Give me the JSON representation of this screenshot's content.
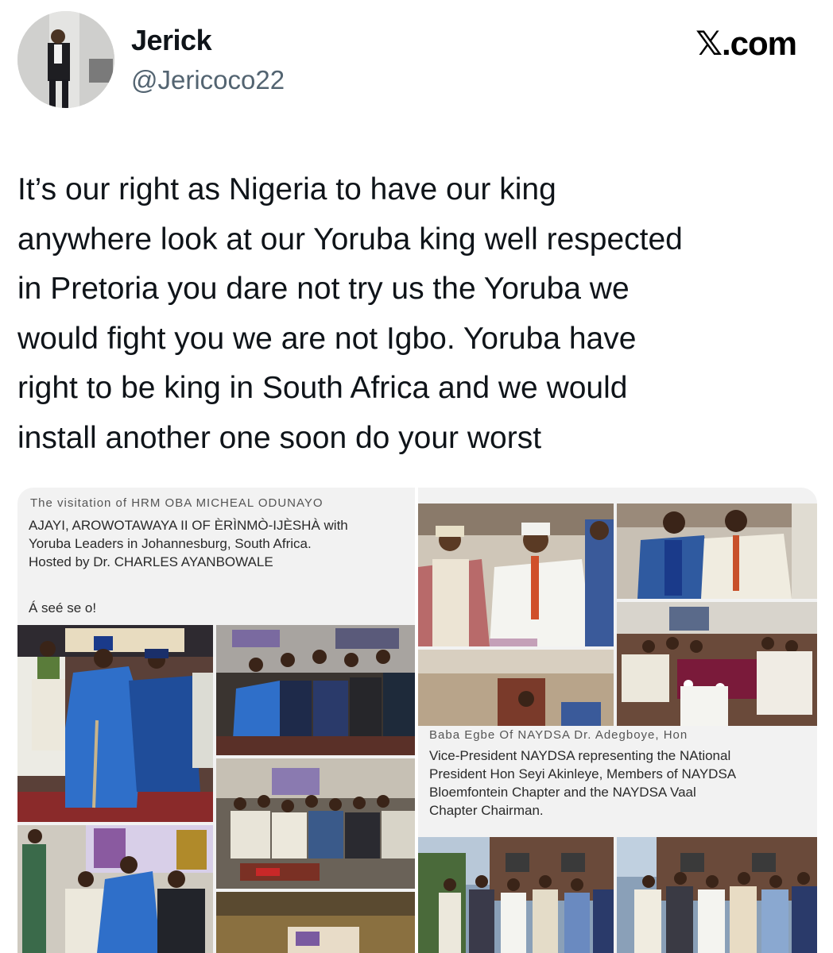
{
  "header": {
    "display_name": "Jerick",
    "handle": "@Jericoco22",
    "source": "𝕏.com"
  },
  "tweet": {
    "lines": [
      "It’s our right as Nigeria to have our king",
      "anywhere look at our Yoruba king well respected",
      "in Pretoria you dare not try us the Yoruba we",
      "would fight you we are not Igbo. Yoruba have",
      "right to be king in South Africa and we would",
      "install another one soon do your worst"
    ]
  },
  "media": {
    "left_post": {
      "caption_cutoff": "The visitation of HRM OBA MICHEAL ODUNAYO",
      "caption": [
        "AJAYI, AROWOTAWAYA II OF ÈRÌNMÒ-IJÈSHÀ with",
        "Yoruba Leaders in Johannesburg, South Africa.",
        "Hosted by Dr. CHARLES AYANBOWALE"
      ],
      "greeting": "Á seé se o!"
    },
    "right_post": {
      "caption_cutoff": "Baba Egbe Of NAYDSA Dr. Adegboye, Hon",
      "caption": [
        "Vice-President NAYDSA representing the NAtional",
        "President Hon Seyi Akinleye, Members of NAYDSA",
        "Bloemfontein Chapter and the NAYDSA Vaal",
        "Chapter Chairman."
      ]
    }
  }
}
